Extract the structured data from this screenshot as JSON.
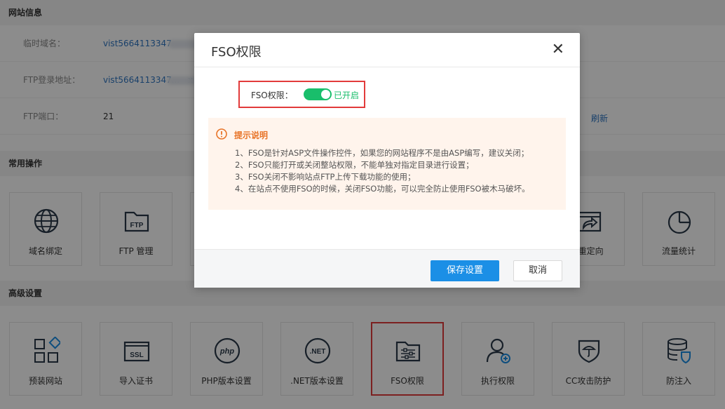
{
  "site_info": {
    "section_title": "网站信息",
    "temp_domain_label": "临时域名：",
    "temp_domain_value": "vist5664113347",
    "ftp_address_label": "FTP登录地址：",
    "ftp_address_value": "vist5664113347...",
    "ftp_address_trail": "x",
    "ftp_port_label": "FTP端口：",
    "ftp_port_value": "21",
    "refresh_link": "刷新"
  },
  "common_ops": {
    "section_title": "常用操作",
    "tiles": [
      {
        "label": "域名绑定",
        "icon": "globe-icon"
      },
      {
        "label": "FTP 管理",
        "icon": "ftp-folder-icon"
      },
      {
        "label": "P重定向",
        "icon": "redirect-icon"
      },
      {
        "label": "流量统计",
        "icon": "pie-chart-icon"
      }
    ]
  },
  "advanced": {
    "section_title": "高级设置",
    "tiles": [
      {
        "label": "预装网站",
        "icon": "apps-grid-icon"
      },
      {
        "label": "导入证书",
        "icon": "ssl-certificate-icon"
      },
      {
        "label": "PHP版本设置",
        "icon": "php-icon"
      },
      {
        "label": ".NET版本设置",
        "icon": "dotnet-icon"
      },
      {
        "label": "FSO权限",
        "icon": "fso-settings-icon"
      },
      {
        "label": "执行权限",
        "icon": "user-add-icon"
      },
      {
        "label": "CC攻击防护",
        "icon": "shield-umbrella-icon"
      },
      {
        "label": "防注入",
        "icon": "database-shield-icon"
      }
    ]
  },
  "modal": {
    "title": "FSO权限",
    "close_icon": "close-icon",
    "fso_label": "FSO权限：",
    "toggle_on": true,
    "toggle_status": "已开启",
    "tip": {
      "title": "提示说明",
      "lines": [
        "1、FSO是针对ASP文件操作控件，如果您的网站程序不是由ASP编写，建议关闭；",
        "2、FSO只能打开或关闭整站权限，不能单独对指定目录进行设置；",
        "3、FSO关闭不影响站点FTP上传下载功能的使用；",
        "4、在站点不使用FSO的时候，关闭FSO功能，可以完全防止使用FSO被木马破坏。"
      ]
    },
    "save_button": "保存设置",
    "cancel_button": "取消"
  },
  "colors": {
    "accent": "#1b8fe6",
    "toggle_on": "#19be6b",
    "highlight": "#e23b3b",
    "tip_bg": "#fff4ec",
    "tip_title": "#e87428",
    "link": "#2f76c2"
  }
}
